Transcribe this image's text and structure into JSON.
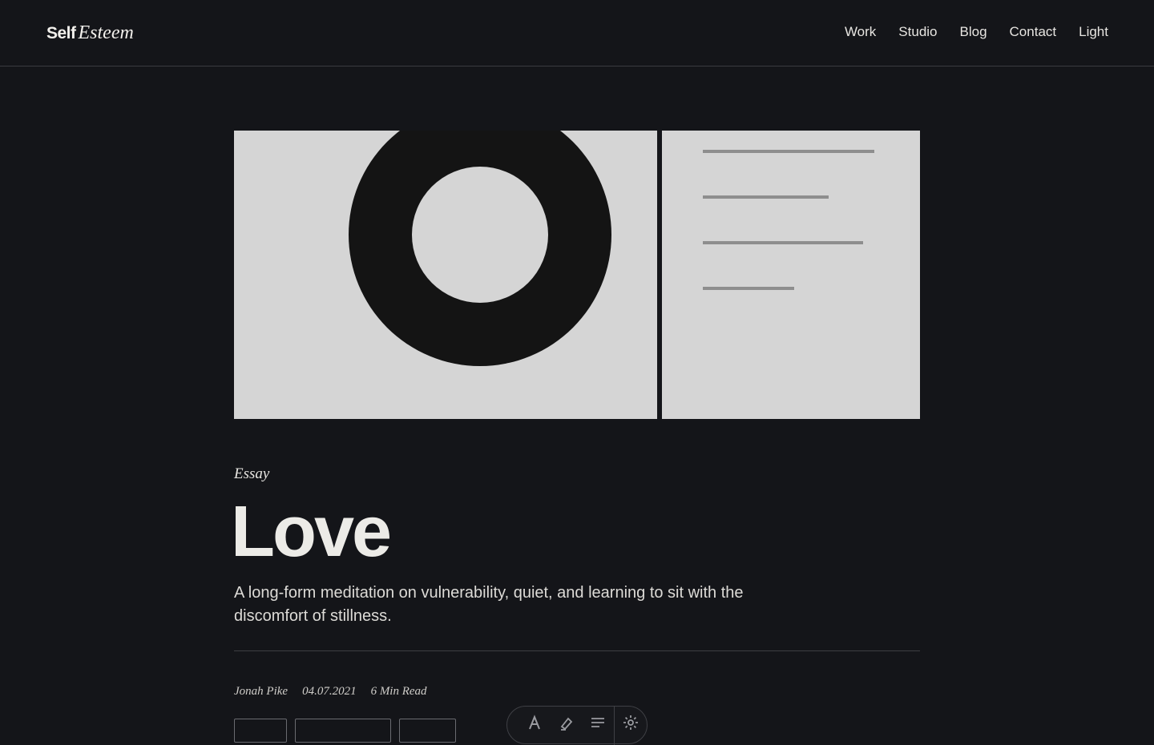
{
  "header": {
    "brand_strong": "Self",
    "brand_italic": "Esteem",
    "nav": [
      "Work",
      "Studio",
      "Blog",
      "Contact",
      "Light"
    ]
  },
  "article": {
    "kicker": "Essay",
    "title": "Love",
    "dek": "A long-form meditation on vulnerability, quiet, and learning to sit with the discomfort of stillness.",
    "meta": {
      "author": "Jonah Pike",
      "date": "04.07.2021",
      "read_time": "6 Min Read"
    }
  },
  "toolbar": {
    "icons": [
      "font-size-icon",
      "highlighter-icon",
      "align-icon",
      "settings-icon"
    ]
  },
  "colors": {
    "background": "#141519",
    "text": "#ecebe7",
    "hero_panel": "#d5d5d5",
    "ring": "#141414",
    "lines": "#8e8e8e"
  }
}
